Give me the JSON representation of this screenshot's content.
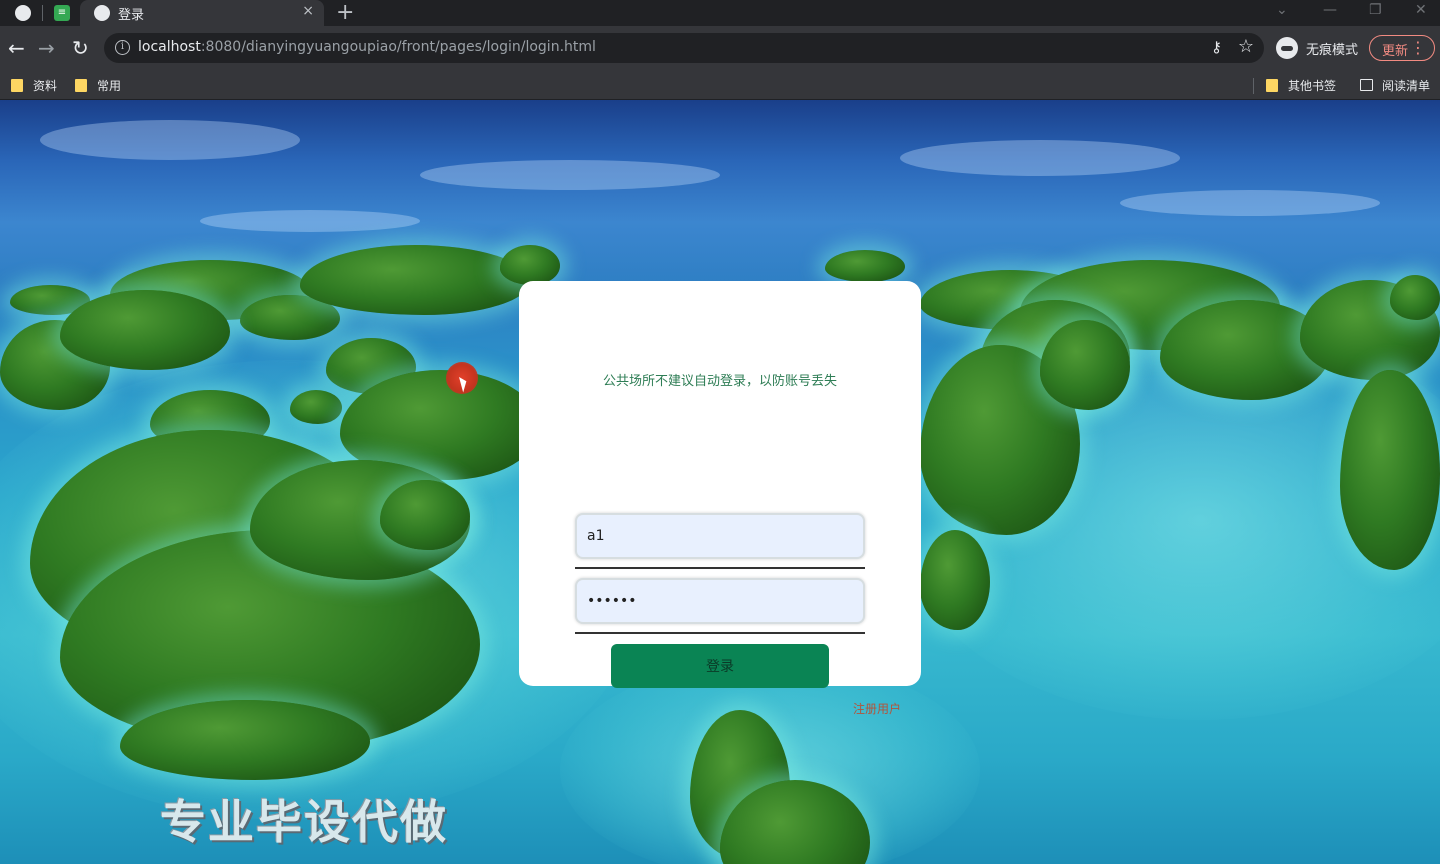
{
  "browser": {
    "tab_title": "登录",
    "tab_close": "×",
    "new_tab": "+",
    "url_host": "localhost",
    "url_rest": ":8080/dianyingyuangoupiao/front/pages/login/login.html",
    "incognito_label": "无痕模式",
    "update_label": "更新",
    "bookmarks_left": [
      "资料",
      "常用"
    ],
    "bookmarks_right": [
      "其他书签",
      "阅读清单"
    ]
  },
  "login": {
    "tip": "公共场所不建议自动登录，以防账号丢失",
    "username_value": "a1",
    "password_value": "••••••",
    "login_button": "登录",
    "register_link": "注册用户"
  },
  "watermark": "专业毕设代做",
  "colors": {
    "primary_button": "#0a8454",
    "tip_text": "#2e7d55",
    "register_link": "#b3543a",
    "input_bg": "#e8f0fe"
  }
}
